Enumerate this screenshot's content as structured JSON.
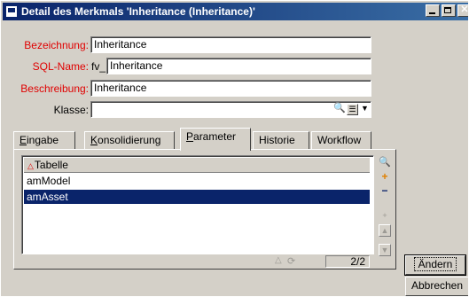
{
  "window": {
    "title": "Detail des Merkmals 'Inheritance (Inheritance)'"
  },
  "form": {
    "bezeichnung": {
      "label": "Bezeichnung:",
      "value": "Inheritance"
    },
    "sqlname": {
      "label": "SQL-Name:",
      "prefix": "fv_",
      "value": "Inheritance"
    },
    "beschreibung": {
      "label": "Beschreibung:",
      "value": "Inheritance"
    },
    "klasse": {
      "label": "Klasse:",
      "value": ""
    }
  },
  "tabs": [
    {
      "label": "Eingabe",
      "accel": "E",
      "rest": "ingabe"
    },
    {
      "label": "Konsolidierung",
      "accel": "K",
      "rest": "onsolidierung"
    },
    {
      "label": "Parameter",
      "accel": "P",
      "rest": "arameter"
    },
    {
      "label": "Historie"
    },
    {
      "label": "Workflow"
    }
  ],
  "table": {
    "header": "Tabelle",
    "rows": [
      "amModel",
      "amAsset"
    ],
    "selected_row": "amAsset",
    "counter": "2/2"
  },
  "buttons": {
    "change": "Ändern",
    "cancel": "Abbrechen"
  },
  "colors": {
    "title_start": "#0a246a",
    "title_end": "#3a6ea5",
    "required_label": "#e00000",
    "selection": "#0a246a"
  }
}
